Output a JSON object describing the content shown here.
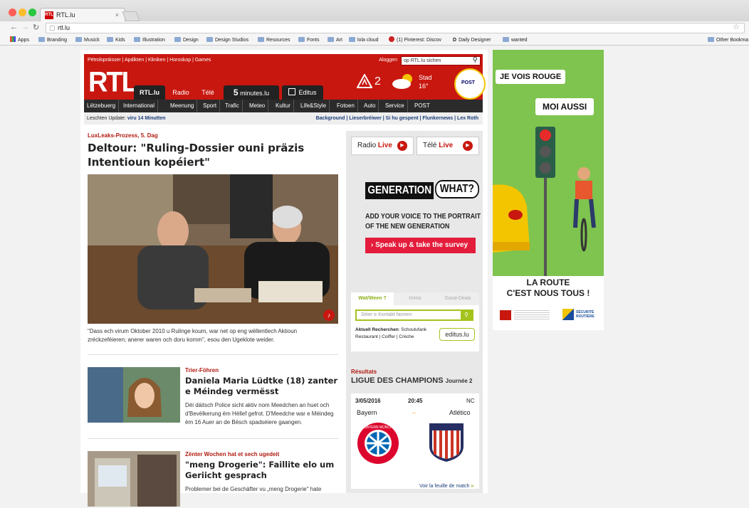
{
  "browser": {
    "tab_title": "RTL.lu",
    "tab_favicon": "RTL",
    "tab_close": "×",
    "url": "rtl.lu",
    "bookmarks": [
      "Apps",
      "Branding",
      "Musick",
      "Kids",
      "Illustration",
      "Design",
      "Design Studios",
      "Resources",
      "Fonts",
      "Art",
      "lola cloud",
      "(1) Pinterest: Discov",
      "Daily Designer",
      "wanted"
    ],
    "other_bookmarks": "Other Bookma"
  },
  "site": {
    "topnav": "Pëtrolspräisser | Apdikten | Kliniken | Horoskop | Games",
    "login": "Aloggen",
    "search_placeholder": "op RTL.lu sichen",
    "logo": "RTL",
    "tabs": [
      "RTL.lu",
      "Radio",
      "Télé",
      "minutes.lu",
      "Editus"
    ],
    "minutes_prefix": "5",
    "warning_count": "2",
    "weather_city": "Stad",
    "weather_temp": "16°",
    "post_logo": "POST",
    "sections": [
      "Lëtzebuerg",
      "International",
      "Meenung",
      "Sport",
      "Trafic",
      "Meteo",
      "Kultur",
      "Life&Style",
      "Fotoen",
      "Auto",
      "Service",
      "POST"
    ],
    "update_label": "Leschten Update:",
    "update_time": "viru 14 Minutten",
    "quicklinks": "Background | Lieserbréiwer | Si hu gespent | Flunkernews | Lex Roth"
  },
  "main": {
    "kicker": "LuxLeaks-Prozess, 5. Dag",
    "headline": "Deltour: \"Ruling-Dossier ouni präzis Intentioun kopéiert\"",
    "caption": "\"Dass ech virum Oktober 2010 u Rulinge koum, war net op eng wëllentlech Aktioun zréckzeféieren; anerer waren och doru komm\", esou den Ugeklote weider.",
    "stories": [
      {
        "kicker": "Trier-Föhren",
        "headline": "Daniela Maria Lüdtke (18) zanter e Méindeg vermësst",
        "body": "Déi däitsch Police sicht aktiv nom Meedchen an huet och d'Bevëlkerung ëm Hëllef gefrot. D'Meedche war e Méindeg ëm 16 Auer an de Bësch spadséiere gaangen."
      },
      {
        "kicker": "Zënter Wochen hat et sech ugedeit",
        "headline": "\"meng Drogerie\": Faillite elo um Geriicht gesprach",
        "body": "Problemer bei de Geschäfter vu „meng Drogerie\" hate"
      }
    ]
  },
  "sidebar": {
    "radio_label": "Radio",
    "tele_label": "Télé",
    "live": "Live",
    "ad_gen1": "GENERATION",
    "ad_gen2": "WHAT?",
    "ad_line1": "ADD YOUR VOICE TO THE PORTRAIT",
    "ad_line2": "OF THE NEW GENERATION",
    "ad_cta": "Speak up & take the survey",
    "editus_tabs": [
      "Wat/Ween ?",
      "Immo",
      "Good-Deals"
    ],
    "editus_placeholder": "Séier e Kontakt fannen",
    "editus_akt_label": "Aktuell Recherchen",
    "editus_akt": ": Schoulufank Restaurant | Coiffer | Crèche",
    "editus_logo": "editus.lu",
    "results_kicker": "Résultats",
    "results_league": "LIGUE DES CHAMPIONS",
    "results_round": "Journée 2",
    "match_date": "3/05/2016",
    "match_time": "20:45",
    "match_status": "NC",
    "home": "Bayern",
    "away": "Atlético",
    "crest_home": "FC BAYERN MÜNCHEN",
    "more": "Voir la feuille de match"
  },
  "ad": {
    "bubble1": "JE VOIS ROUGE",
    "bubble2": "MOI AUSSI",
    "line1": "LA ROUTE",
    "line2": "C'EST NOUS TOUS !",
    "sponsor": "SÉCURITÉ ROUTIÈRE"
  }
}
